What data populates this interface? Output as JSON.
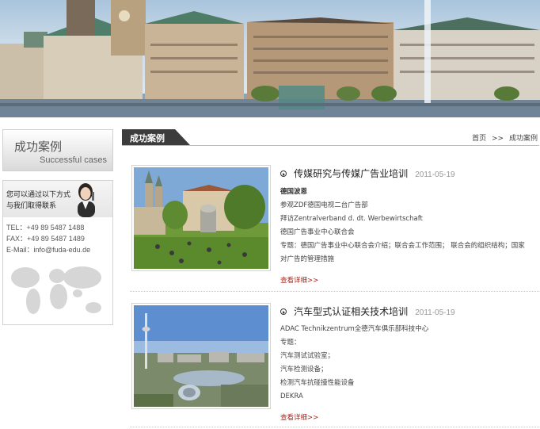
{
  "sidebar": {
    "heading_cn": "成功案例",
    "heading_en": "Successful cases",
    "contact_line1": "您可以通过以下方式",
    "contact_line2": "与我们取得联系",
    "tel": "TEL：+49 89 5487 1488",
    "fax": "FAX：+49 89 5487 1489",
    "email": "E-Mail：info@fuda-edu.de"
  },
  "main": {
    "tab_label": "成功案例",
    "breadcrumb": {
      "home": "首页",
      "separator": ">>",
      "current": "成功案例"
    }
  },
  "articles": [
    {
      "title": "传媒研究与传媒广告业培训",
      "date": "2011-05-19",
      "lines": [
        "德国波恩",
        "参观ZDF德国电视二台广告部",
        "拜访Zentralverband d. dt. Werbewirtschaft",
        "德国广告事业中心联合会",
        "专题：德国广告事业中心联合会介绍；联合会工作范围； 联合会的组织结构；国家",
        "对广告的管理措施"
      ],
      "more": "查看详细>>",
      "image": "city-square-photo"
    },
    {
      "title": "汽车型式认证相关技术培训",
      "date": "2011-05-19",
      "lines": [
        "ADAC Technikzentrum全德汽车俱乐部科技中心",
        "专题：",
        "汽车测试试验室；",
        "汽车检测设备；",
        "检测汽车抗碰撞性能设备",
        "DEKRA"
      ],
      "more": "查看详细>>",
      "image": "olympic-tower-photo"
    }
  ],
  "colors": {
    "tab_bg": "#3c3c3c",
    "more_link": "#a8281e",
    "date": "#999999"
  }
}
